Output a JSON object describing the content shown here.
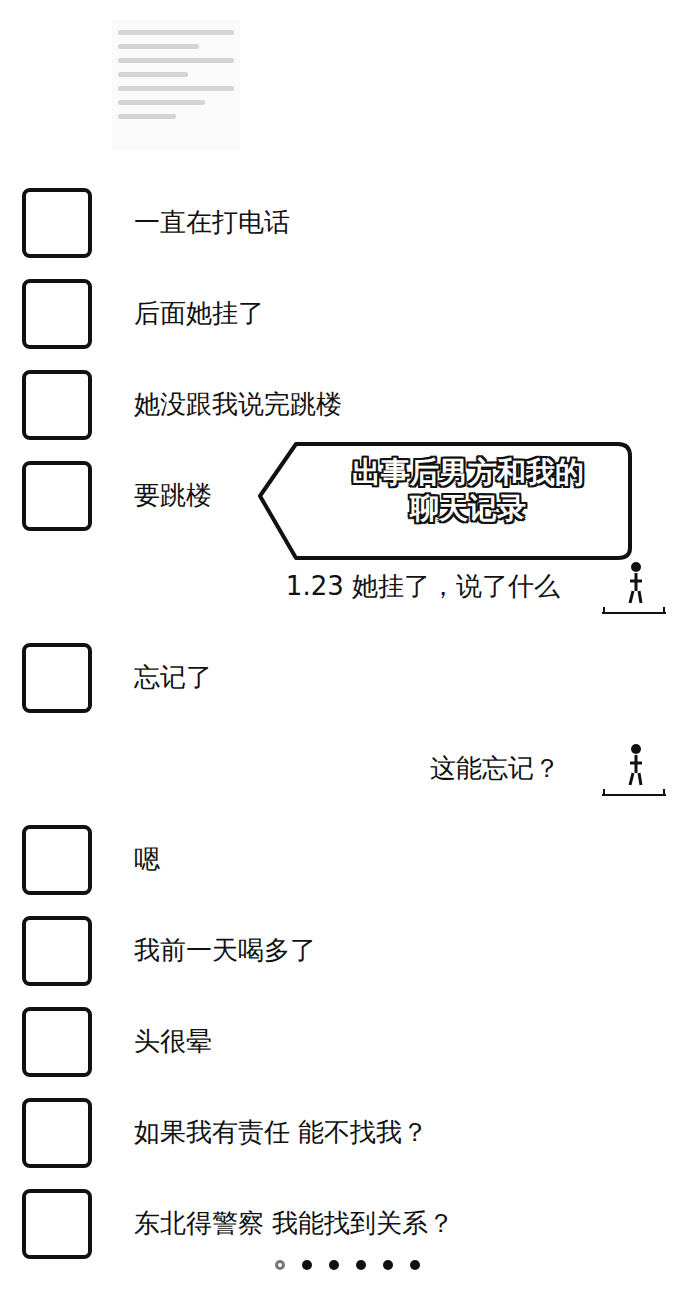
{
  "annotation": {
    "lines": [
      "出事后男方和我的",
      "聊天记录"
    ]
  },
  "messages": [
    {
      "kind": "received",
      "text": "一直在打电话"
    },
    {
      "kind": "received",
      "text": "后面她挂了"
    },
    {
      "kind": "received",
      "text": "她没跟我说完跳楼"
    },
    {
      "kind": "received",
      "text": "要跳楼"
    },
    {
      "kind": "sent",
      "text": "1.23 她挂了，说了什么"
    },
    {
      "kind": "received",
      "text": "忘记了"
    },
    {
      "kind": "sent",
      "text": "这能忘记？"
    },
    {
      "kind": "received",
      "text": "嗯"
    },
    {
      "kind": "received",
      "text": "我前一天喝多了"
    },
    {
      "kind": "received",
      "text": "头很晕"
    },
    {
      "kind": "received",
      "text": "如果我有责任 能不找我？"
    },
    {
      "kind": "received",
      "text": "东北得警察 我能找到关系？"
    }
  ],
  "pagination": [
    {
      "selected": true
    },
    {
      "selected": false
    },
    {
      "selected": false
    },
    {
      "selected": false
    },
    {
      "selected": false
    },
    {
      "selected": false
    }
  ]
}
